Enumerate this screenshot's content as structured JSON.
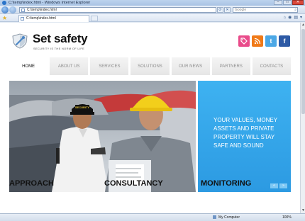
{
  "browser": {
    "window_title": "C:\\temp\\index.html - Windows Internet Explorer",
    "address": "C:\\temp\\index.html",
    "search_placeholder": "Google",
    "tab_title": "C:\\temp\\index.html",
    "window_buttons": {
      "minimize": "–",
      "maximize": "□",
      "close": "✕"
    },
    "status": {
      "zone": "My Computer",
      "zoom": "100%"
    }
  },
  "site": {
    "logo_title": "Set safety",
    "logo_tagline": "SECURITY IS THE NORM OF LIFE",
    "social": [
      {
        "name": "tag-icon",
        "color": "#e94b8a"
      },
      {
        "name": "rss-icon",
        "color": "#f07a18"
      },
      {
        "name": "twitter-icon",
        "color": "#4ca8e6"
      },
      {
        "name": "facebook-icon",
        "color": "#2d5aa5"
      }
    ],
    "menu": [
      {
        "label": "HOME",
        "active": true
      },
      {
        "label": "ABOUT US",
        "active": false
      },
      {
        "label": "SERVICES",
        "active": false
      },
      {
        "label": "SOLUTIONS",
        "active": false
      },
      {
        "label": "OUR NEWS",
        "active": false
      },
      {
        "label": "PARTNERS",
        "active": false
      },
      {
        "label": "CONTACTS",
        "active": false
      }
    ],
    "hero_cap_text": "SECURITY",
    "panel_text": "YOUR VALUES, MONEY ASSETS AND PRIVATE PROPERTY WILL STAY SAFE AND SOUND",
    "slider": {
      "prev": "«",
      "next": "»"
    },
    "sections": [
      "APPROACH",
      "CONSULTANCY",
      "MONITORING"
    ],
    "colors": {
      "panel": "#33a6ec",
      "accent": "#111111"
    }
  }
}
